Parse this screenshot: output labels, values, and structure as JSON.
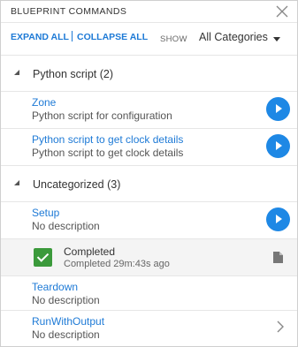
{
  "header": {
    "title": "BLUEPRINT COMMANDS"
  },
  "toolbar": {
    "expand_all": "EXPAND ALL",
    "collapse_all": "COLLAPSE ALL",
    "show_label": "SHOW",
    "filter_value": "All Categories"
  },
  "groups": [
    {
      "label": "Python script (2)",
      "items": [
        {
          "name": "Zone",
          "description": "Python script for configuration"
        },
        {
          "name": "Python script to get clock details",
          "description": "Python script to get clock details"
        }
      ]
    },
    {
      "label": "Uncategorized (3)",
      "items": [
        {
          "name": "Setup",
          "description": "No description"
        },
        {
          "name": "Teardown",
          "description": "No description"
        },
        {
          "name": "RunWithOutput",
          "description": "No description"
        }
      ]
    }
  ],
  "run_result": {
    "status": "Completed",
    "detail": "Completed 29m:43s ago"
  },
  "colors": {
    "accent": "#1e7ad6",
    "play_button": "#1e88e5",
    "success": "#3b9a3b"
  },
  "icons": [
    "close-icon",
    "chevron-down-icon",
    "collapse-arrow-icon",
    "play-icon",
    "check-icon",
    "document-icon",
    "chevron-right-icon"
  ]
}
